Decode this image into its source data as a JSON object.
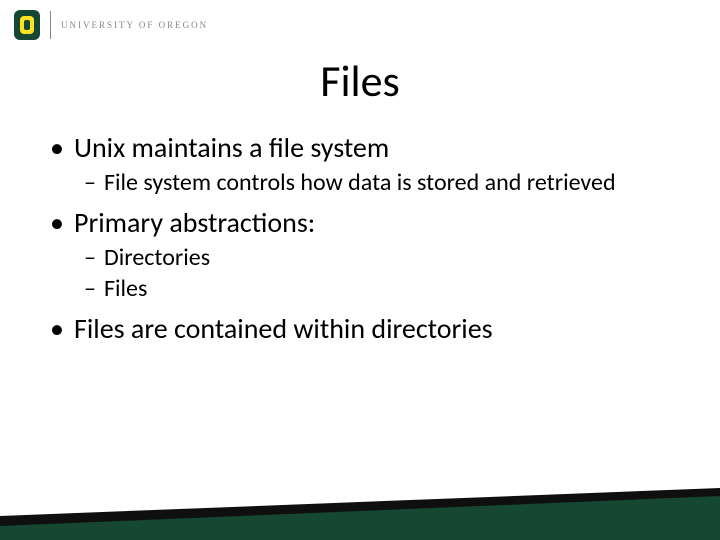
{
  "header": {
    "university": "UNIVERSITY OF OREGON",
    "logo_alt": "oregon-o-logo",
    "brand_green": "#154733",
    "brand_yellow": "#fee123"
  },
  "title": "Files",
  "bullets": [
    {
      "text": "Unix maintains a file system",
      "children": [
        {
          "text": "File system controls how data is stored and retrieved"
        }
      ]
    },
    {
      "text": "Primary abstractions:",
      "children": [
        {
          "text": "Directories"
        },
        {
          "text": "Files"
        }
      ]
    },
    {
      "text": "Files are contained within directories",
      "children": []
    }
  ]
}
